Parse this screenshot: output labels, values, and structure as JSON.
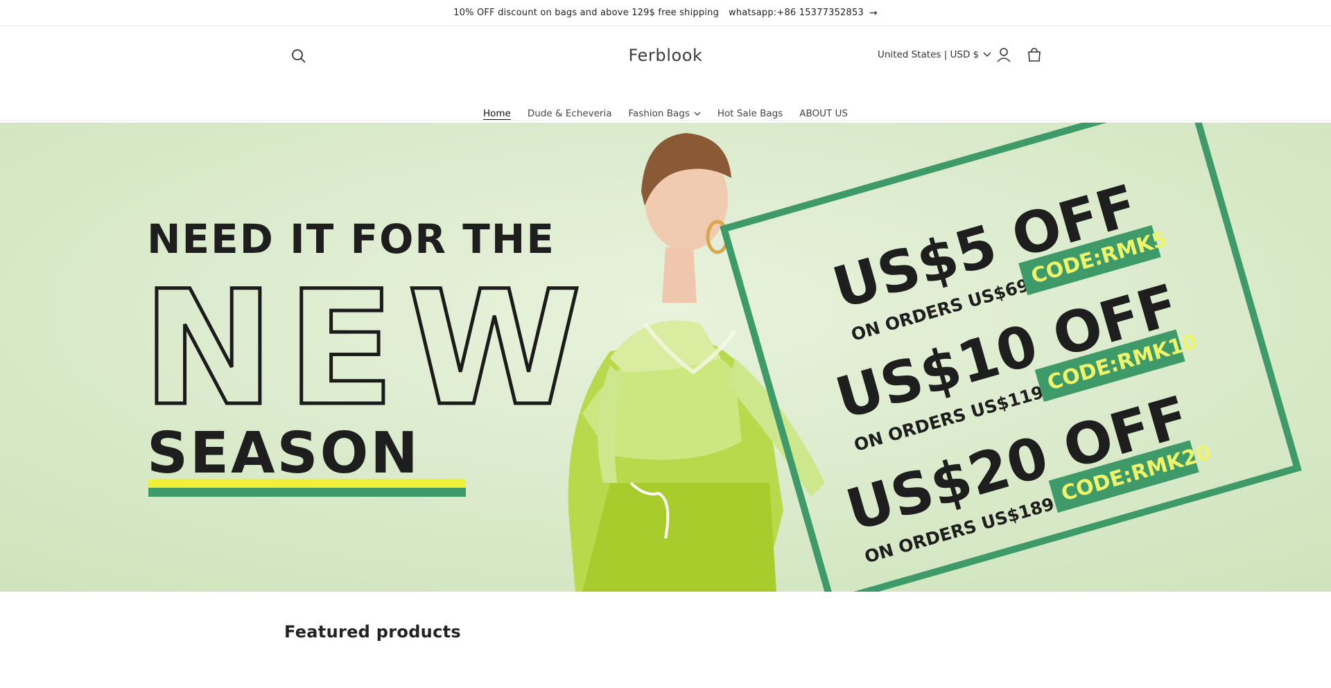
{
  "announcement": {
    "text": "10% OFF discount on bags and above 129$ free shipping",
    "contact": "whatsapp:+86 15377352853",
    "arrow_icon": "arrow-right-icon"
  },
  "header": {
    "brand": "Ferblook",
    "locale": "United States | USD $",
    "icons": [
      "search-icon",
      "account-icon",
      "cart-icon"
    ]
  },
  "nav": {
    "items": [
      {
        "label": "Home",
        "active": true
      },
      {
        "label": "Dude & Echeveria"
      },
      {
        "label": "Fashion Bags",
        "dropdown": true
      },
      {
        "label": "Hot Sale Bags"
      },
      {
        "label": "ABOUT US"
      }
    ]
  },
  "hero": {
    "headline_1": "NEED IT FOR THE",
    "headline_2": "NEW",
    "headline_3": "SEASON",
    "offers": [
      {
        "amount": "US$5 OFF",
        "code": "CODE:RMK5",
        "condition": "ON ORDERS US$69+"
      },
      {
        "amount": "US$10 OFF",
        "code": "CODE:RMK10",
        "condition": "ON ORDERS US$119+"
      },
      {
        "amount": "US$20 OFF",
        "code": "CODE:RMK20",
        "condition": "ON ORDERS US$189+"
      }
    ],
    "colors": {
      "background": "#d6e8c4",
      "frame": "#3f9a6a",
      "code_bg": "#3f9a6a",
      "code_text": "#eef56b",
      "accent_yellow": "#f0ef3a"
    }
  },
  "featured": {
    "title": "Featured products"
  }
}
